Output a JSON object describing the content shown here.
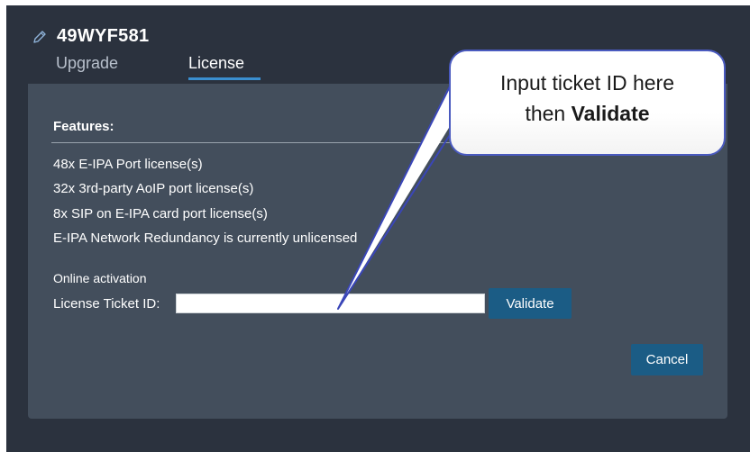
{
  "device": {
    "name": "49WYF581",
    "icon": "pencil-icon"
  },
  "tabs": [
    {
      "label": "Upgrade",
      "active": false
    },
    {
      "label": "License",
      "active": true
    }
  ],
  "features": {
    "title": "Features:",
    "items": [
      "48x E-IPA Port license(s)",
      "32x 3rd-party AoIP port license(s)",
      "8x SIP on E-IPA card port license(s)",
      "E-IPA Network Redundancy is currently unlicensed"
    ]
  },
  "activation": {
    "heading": "Online activation",
    "ticket_label": "License Ticket ID:",
    "ticket_value": "",
    "validate_label": "Validate"
  },
  "actions": {
    "cancel_label": "Cancel"
  },
  "callout": {
    "line1": "Input ticket ID here",
    "line2_prefix": "then ",
    "line2_bold": "Validate"
  },
  "colors": {
    "background": "#2b323e",
    "panel": "#434e5c",
    "button": "#1b5c85",
    "tab_underline": "#3a8fd0",
    "callout_border": "#4a5abf"
  }
}
